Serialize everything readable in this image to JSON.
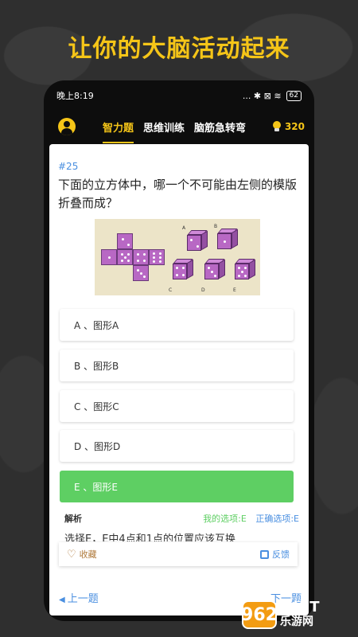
{
  "headline": "让你的大脑活动起来",
  "status": {
    "time": "晚上8:19",
    "icons_text": "... ✱ ⊠ ≋",
    "battery": "62"
  },
  "nav": {
    "tabs": [
      "智力题",
      "思维训练",
      "脑筋急转弯"
    ],
    "active_tab": "智力题",
    "points": "320"
  },
  "question": {
    "number": "#25",
    "text": "下面的立方体中，哪一个不可能由左侧的模版折叠而成？",
    "figure_labels": [
      "A",
      "B",
      "C",
      "D",
      "E"
    ]
  },
  "options": [
    {
      "label": "A 、图形A",
      "state": "normal"
    },
    {
      "label": "B 、图形B",
      "state": "normal"
    },
    {
      "label": "C 、图形C",
      "state": "normal"
    },
    {
      "label": "D 、图形D",
      "state": "normal"
    },
    {
      "label": "E 、图形E",
      "state": "correct"
    }
  ],
  "analysis": {
    "title": "解析",
    "my_choice": "我的选项:E",
    "correct_choice": "正确选项:E",
    "text": "选择E，E中4点和1点的位置应该互换"
  },
  "actions": {
    "favorite": "收藏",
    "feedback": "反馈"
  },
  "pager": {
    "prev": "上一题",
    "next": "下一题"
  },
  "watermark": {
    "badge": "962",
    "net": ".NET",
    "cn": "乐游网"
  },
  "colors": {
    "accent": "#f5c518",
    "link": "#4a8fe0",
    "correct": "#5ecf63"
  }
}
